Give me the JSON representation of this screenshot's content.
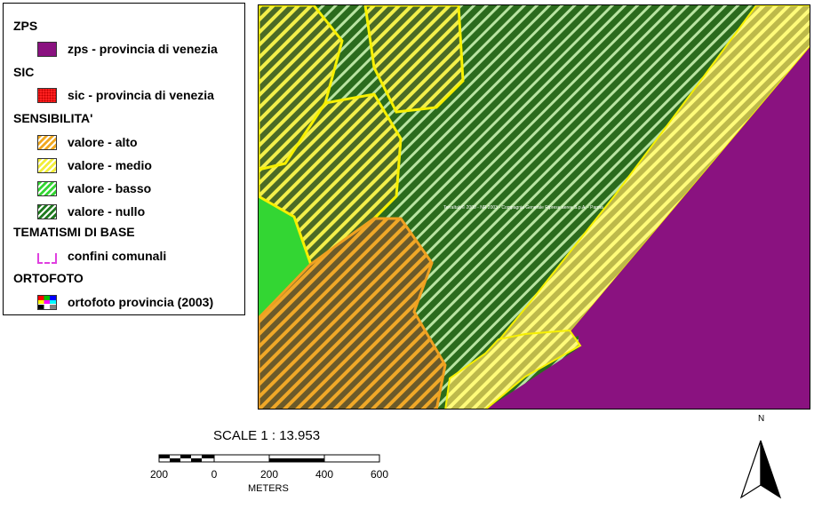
{
  "legend": {
    "sections": [
      {
        "title": "ZPS",
        "items": [
          {
            "label": "zps - provincia di venezia",
            "swatch": "zps"
          }
        ]
      },
      {
        "title": "SIC",
        "items": [
          {
            "label": "sic - provincia di venezia",
            "swatch": "sic"
          }
        ]
      },
      {
        "title": "SENSIBILITA'",
        "items": [
          {
            "label": "valore - alto",
            "swatch": "alto"
          },
          {
            "label": "valore - medio",
            "swatch": "medio"
          },
          {
            "label": "valore - basso",
            "swatch": "basso"
          },
          {
            "label": "valore - nullo",
            "swatch": "nullo"
          }
        ]
      },
      {
        "title": "TEMATISMI DI BASE",
        "items": [
          {
            "label": "confini comunali",
            "swatch": "confini"
          }
        ]
      },
      {
        "title": "ORTOFOTO",
        "items": [
          {
            "label": "ortofoto provincia (2003)",
            "swatch": "ortofoto"
          }
        ]
      }
    ]
  },
  "colors": {
    "zps": "#8a1280",
    "sic": "#ff1a1a",
    "alto": "#f0a820",
    "medio": "#f2ee3a",
    "basso": "#33d633",
    "nullo": "#1f7a1f",
    "confini": "#e040e0"
  },
  "map": {
    "copyright": "TerraItaly© 2000 - NR 2003 - Compagnia Generale Riprese aeree S.p.A. - Parma"
  },
  "scale": {
    "text": "SCALE 1 : 13.953",
    "ticks": [
      "200",
      "0",
      "200",
      "400",
      "600"
    ],
    "units": "METERS"
  },
  "north": {
    "label": "N"
  }
}
